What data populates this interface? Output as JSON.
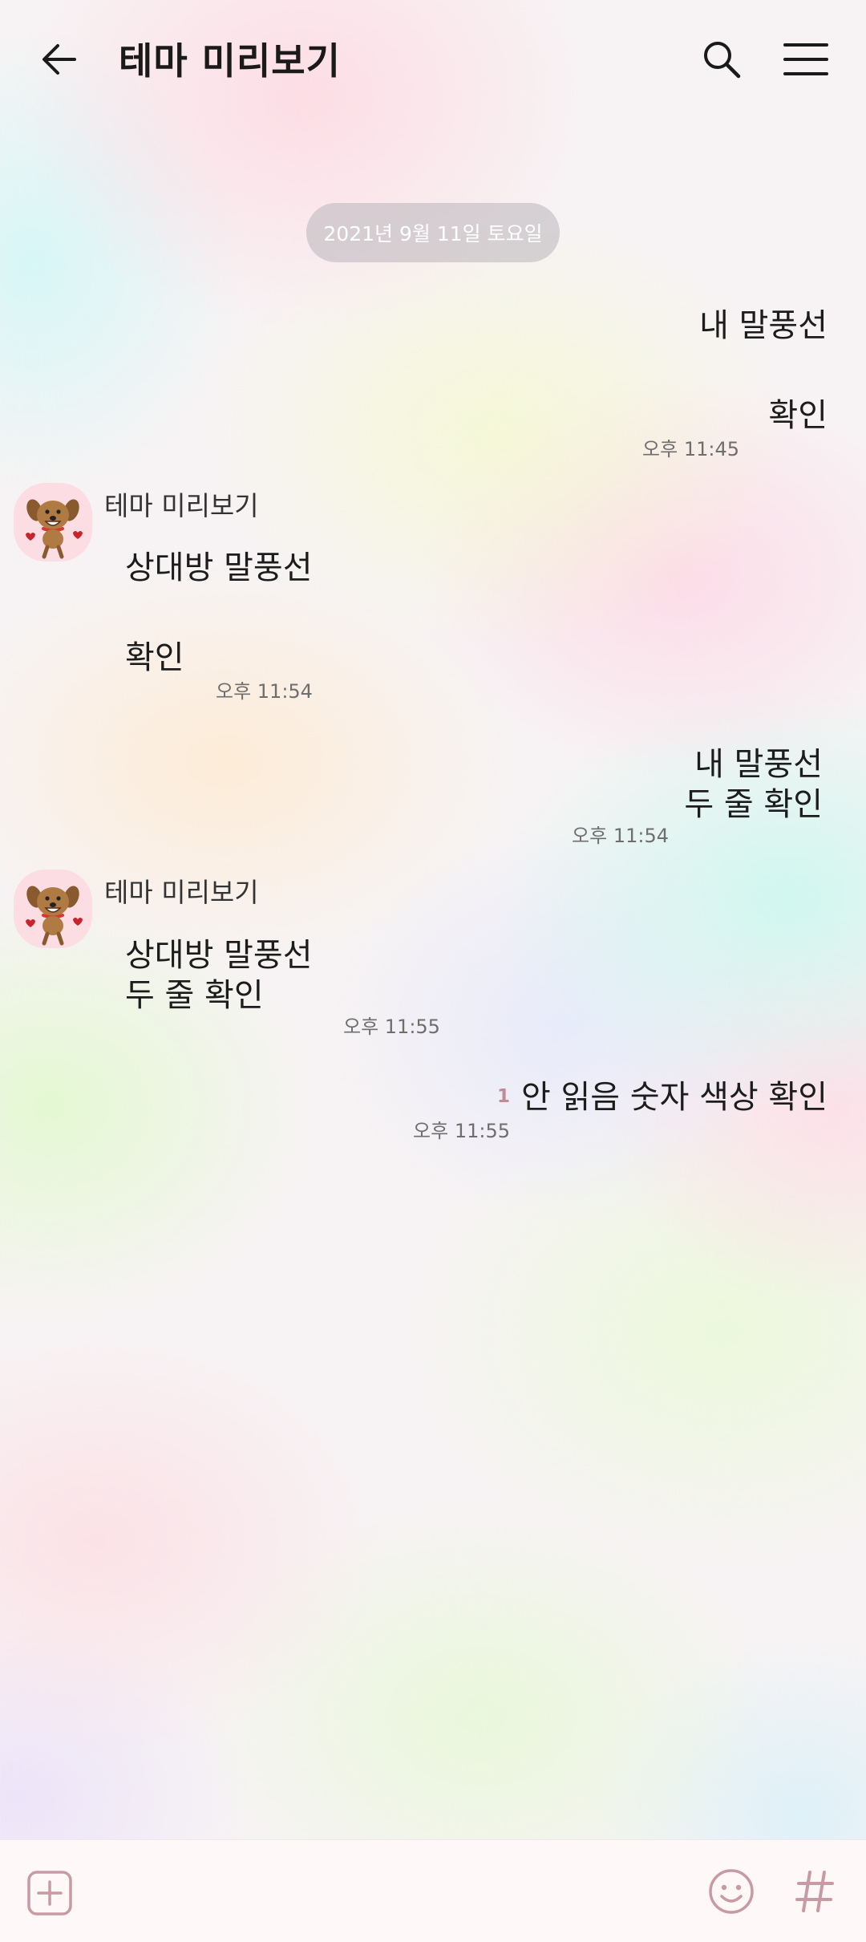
{
  "header": {
    "title": "테마 미리보기"
  },
  "date_divider": "2021년 9월 11일 토요일",
  "messages": {
    "m1": {
      "text": "내 말풍선"
    },
    "m2": {
      "text": "확인",
      "time": "오후 11:45"
    },
    "m3": {
      "sender": "테마 미리보기",
      "text": "상대방 말풍선"
    },
    "m4": {
      "text": "확인",
      "time": "오후 11:54"
    },
    "m5": {
      "line1": "내 말풍선",
      "line2": "두 줄 확인",
      "time": "오후 11:54"
    },
    "m6": {
      "sender": "테마 미리보기",
      "line1": "상대방 말풍선",
      "line2": "두 줄 확인",
      "time": "오후 11:55"
    },
    "m7": {
      "text": "안 읽음 숫자 색상 확인",
      "time": "오후 11:55",
      "unread_count": "1"
    }
  },
  "icons": {
    "back": "back-arrow-icon",
    "search": "search-icon",
    "menu": "hamburger-menu-icon",
    "add": "plus-icon",
    "emoji": "emoji-icon",
    "hashtag": "hashtag-icon",
    "avatar": "dog-character-avatar"
  },
  "colors": {
    "unread": "#c38a96",
    "date_pill": "#bab4ba",
    "avatar_bg": "#fbdde3",
    "input_bar": "#fff8f8"
  }
}
